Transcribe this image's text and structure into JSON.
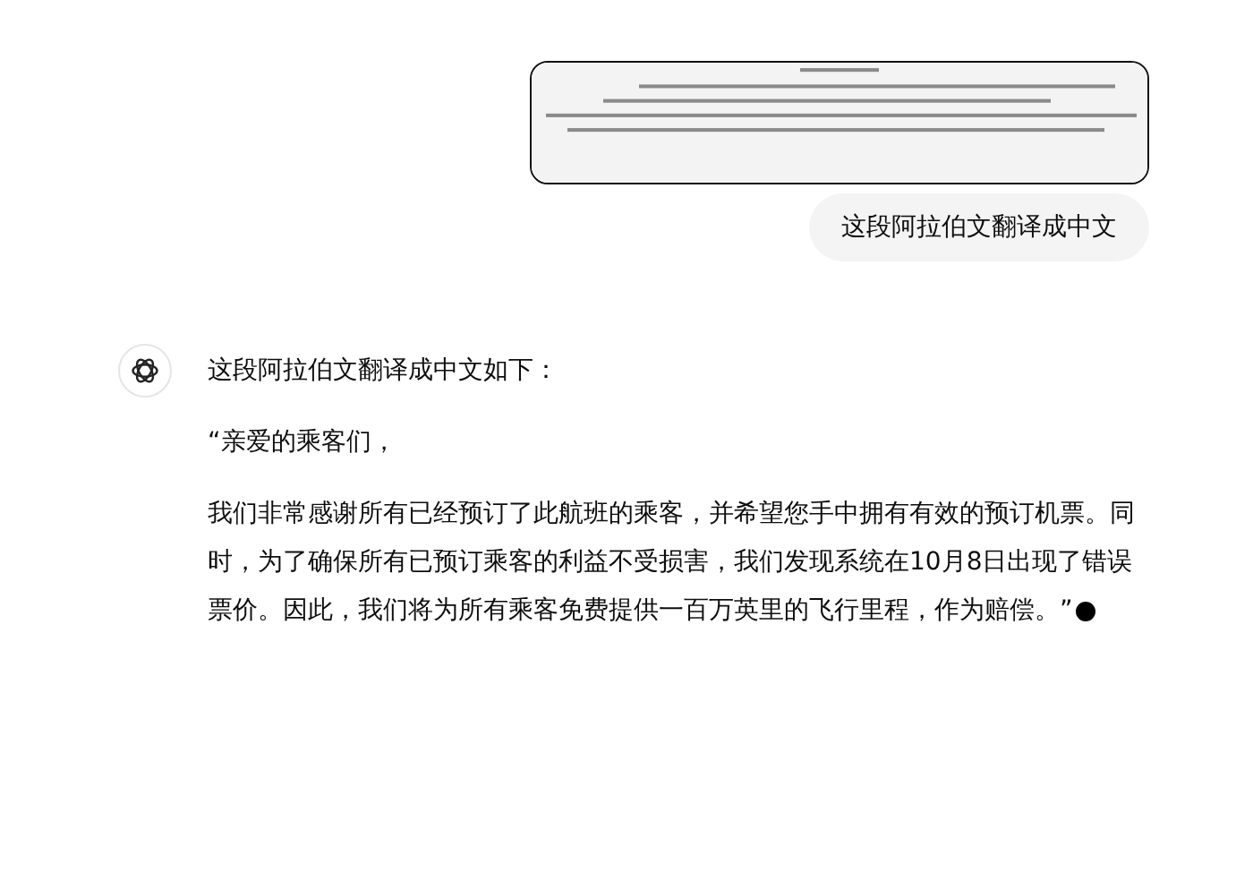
{
  "user_message": {
    "text": "这段阿拉伯文翻译成中文"
  },
  "assistant_message": {
    "paragraphs": [
      "这段阿拉伯文翻译成中文如下：",
      "“亲爱的乘客们，",
      "我们非常感谢所有已经预订了此航班的乘客，并希望您手中拥有有效的预订机票。同时，为了确保所有已预订乘客的利益不受损害，我们发现系统在10月8日出现了错误票价。因此，我们将为所有乘客免费提供一百万英里的飞行里程，作为赔偿。”"
    ],
    "streaming": true
  }
}
